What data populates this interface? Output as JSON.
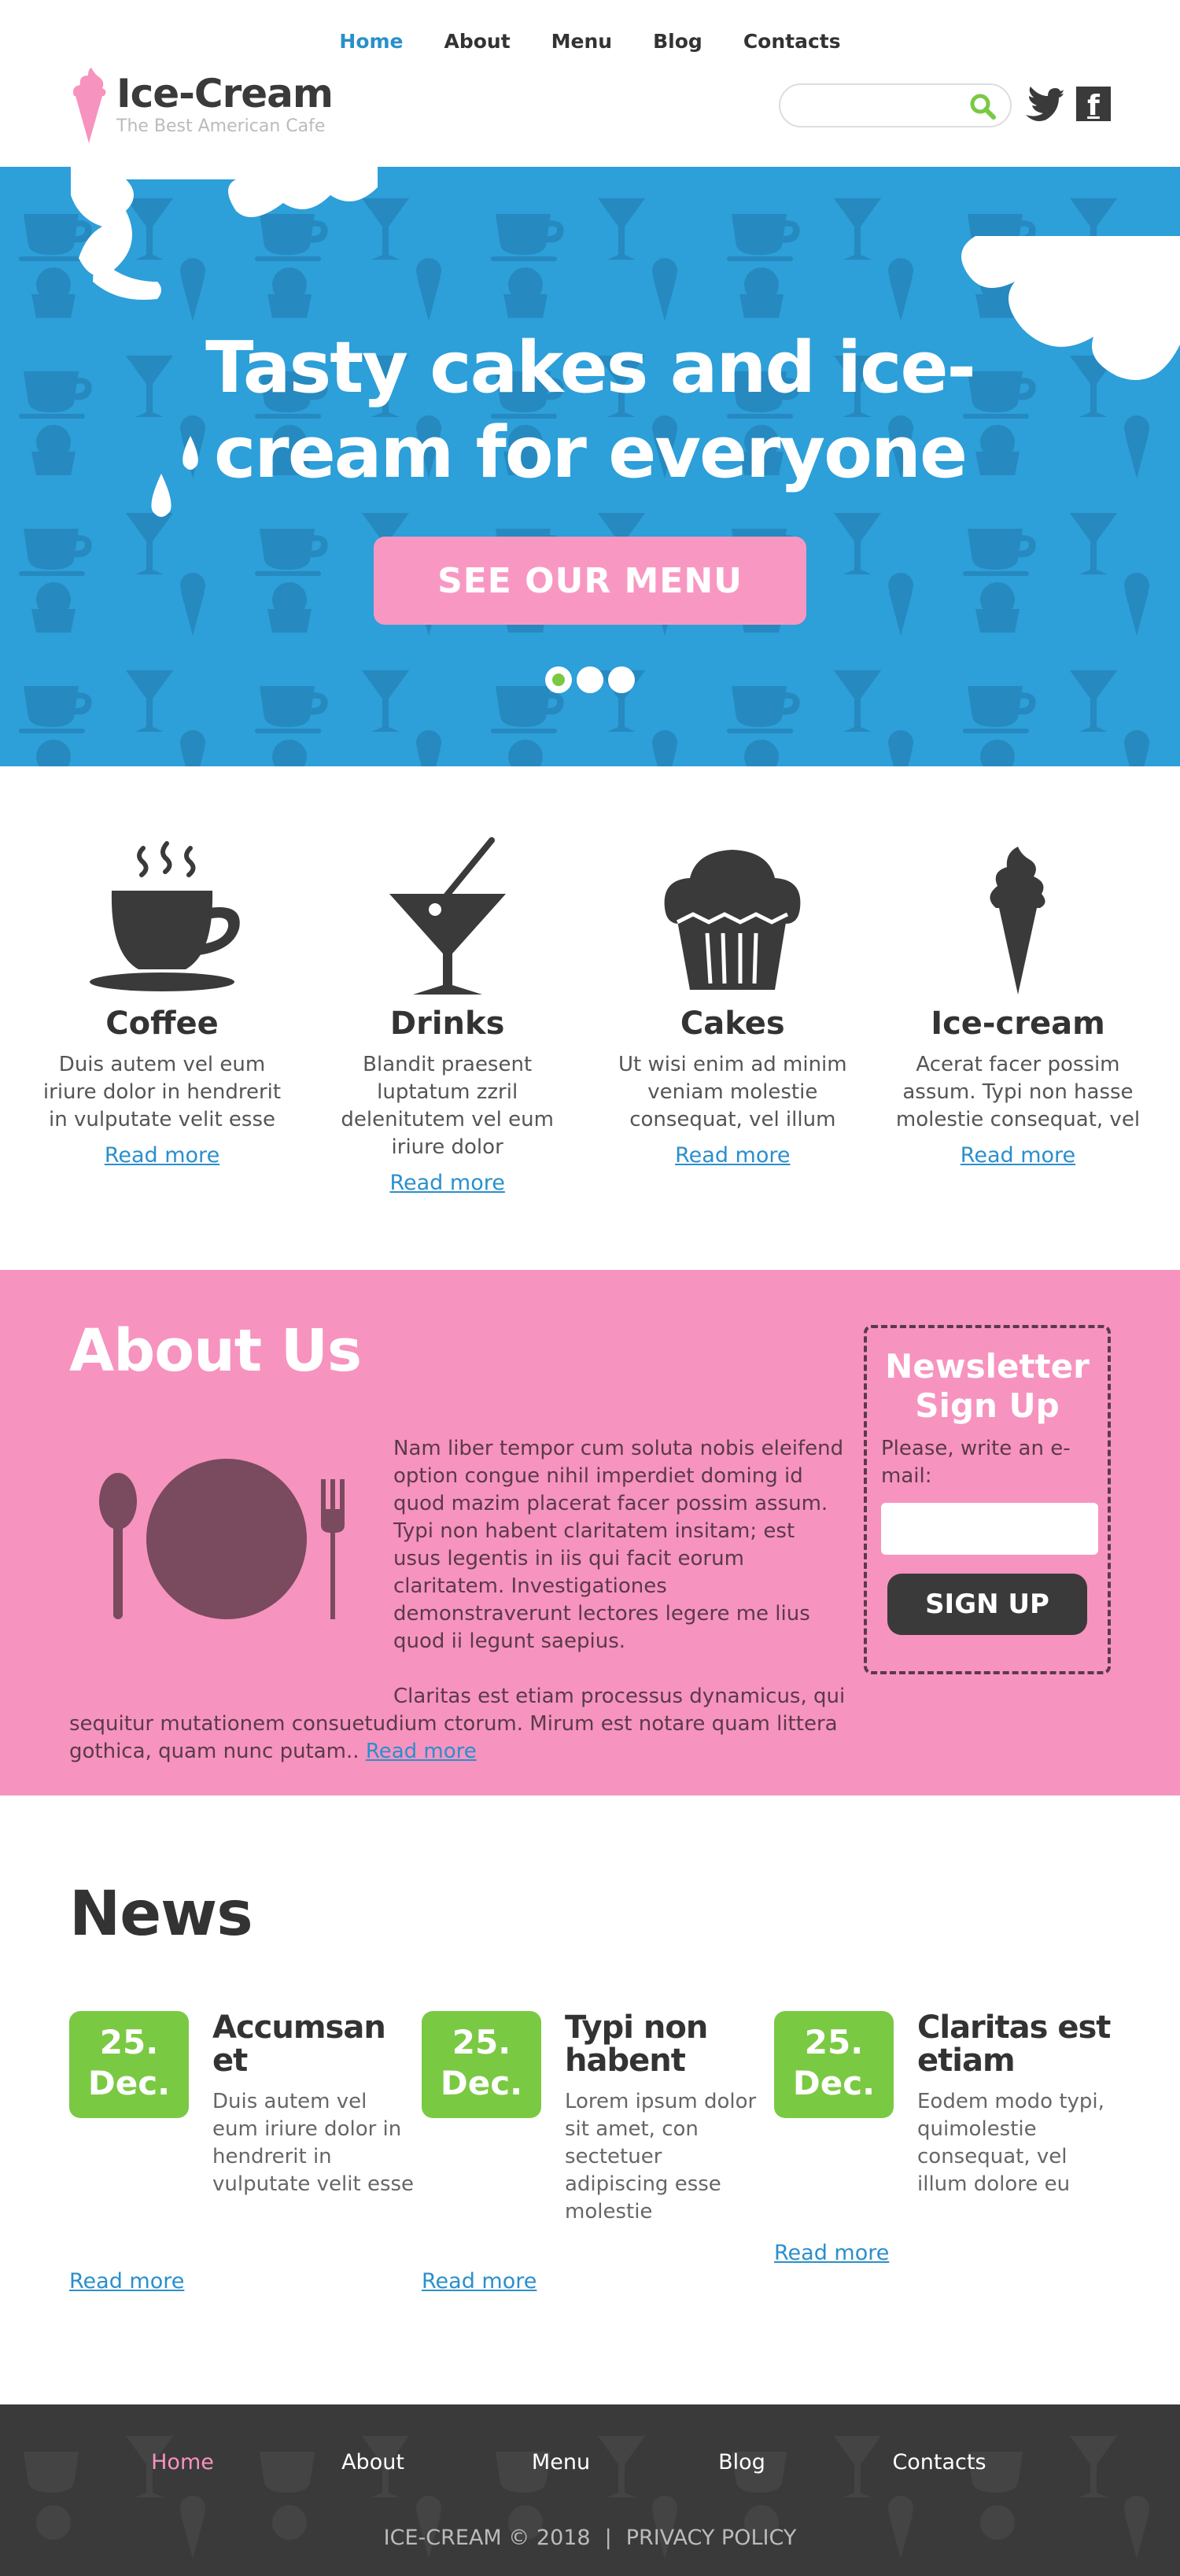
{
  "header": {
    "nav": [
      {
        "label": "Home",
        "active": true
      },
      {
        "label": "About",
        "active": false
      },
      {
        "label": "Menu",
        "active": false
      },
      {
        "label": "Blog",
        "active": false
      },
      {
        "label": "Contacts",
        "active": false
      }
    ],
    "logo_title": "Ice-Cream",
    "logo_subtitle": "The Best American Cafe",
    "search_value": "",
    "social": [
      "twitter-icon",
      "facebook-icon"
    ],
    "facebook_glyph": "f"
  },
  "hero": {
    "headline": "Tasty cakes and ice-cream for everyone",
    "cta_label": "SEE OUR MENU",
    "slides": 3,
    "active_slide": 1
  },
  "features": [
    {
      "icon": "coffee-icon",
      "title": "Coffee",
      "text": "Duis autem vel eum iriure dolor in hendrerit in vulputate velit esse",
      "link": "Read more"
    },
    {
      "icon": "drinks-icon",
      "title": "Drinks",
      "text": "Blandit praesent luptatum zzril delenitutem vel eum iriure dolor",
      "link": "Read more"
    },
    {
      "icon": "cupcake-icon",
      "title": "Cakes",
      "text": "Ut wisi enim ad minim veniam molestie consequat, vel illum",
      "link": "Read more"
    },
    {
      "icon": "ice-cream-icon",
      "title": "Ice-cream",
      "text": "Acerat facer possim assum. Typi non hasse molestie consequat, vel",
      "link": "Read more"
    }
  ],
  "about": {
    "title": "About Us",
    "paragraph1": "Nam liber tempor cum soluta nobis eleifend option congue nihil imperdiet doming id quod mazim placerat facer possim assum. Typi non habent claritatem insitam; est usus legentis in iis qui facit eorum claritatem. Investigationes demonstraverunt lectores legere me lius quod ii legunt saepius.",
    "paragraph2": "Claritas est etiam processus dynamicus, qui sequitur mutationem consuetudium ctorum. Mirum est notare quam littera gothica, quam nunc putam..",
    "link": "Read more"
  },
  "newsletter": {
    "title": "Newsletter Sign Up",
    "prompt": "Please, write an e-mail:",
    "email_value": "",
    "button": "SIGN UP"
  },
  "news": {
    "title": "News",
    "items": [
      {
        "day": "25.",
        "month": "Dec.",
        "title": "Accumsan et",
        "text": "Duis autem vel eum iriure dolor in hendrerit in vulputate velit esse",
        "link": "Read more"
      },
      {
        "day": "25.",
        "month": "Dec.",
        "title": "Typi non habent",
        "text": "Lorem ipsum dolor sit amet, con sectetuer adipiscing esse molestie",
        "link": "Read more"
      },
      {
        "day": "25.",
        "month": "Dec.",
        "title": "Claritas est etiam",
        "text": "Eodem modo typi, quimolestie consequat, vel illum dolore eu",
        "link": "Read more"
      }
    ]
  },
  "footer": {
    "nav": [
      {
        "label": "Home",
        "active": true
      },
      {
        "label": "About",
        "active": false
      },
      {
        "label": "Menu",
        "active": false
      },
      {
        "label": "Blog",
        "active": false
      },
      {
        "label": "Contacts",
        "active": false
      }
    ],
    "copyright": "ICE-CREAM © 2018",
    "separator": "|",
    "policy": "PRIVACY POLICY"
  },
  "colors": {
    "hero_blue": "#2d9fd9",
    "pink": "#f793bf",
    "green": "#7ac943",
    "dark": "#3a3a3a",
    "link_blue": "#2a8fcc"
  }
}
